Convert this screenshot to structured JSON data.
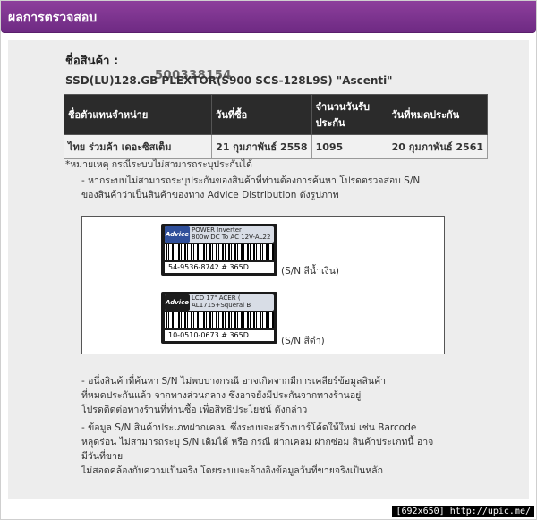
{
  "header": {
    "title": "ผลการตรวจสอบ"
  },
  "product": {
    "label": "ชื่อสินค้า :",
    "serial": "500338154",
    "model": "SSD(LU)128.GB PLEXTOR(S900 SCS-128L9S) \"Ascenti\""
  },
  "table": {
    "headers": [
      "ชื่อตัวแทนจำหน่าย",
      "วันที่ซื้อ",
      "จำนวนวันรับประกัน",
      "วันที่หมดประกัน"
    ],
    "rows": [
      [
        "ไทย ร่วมค้า เดอะซิสเต็ม",
        "21 กุมภาพันธ์ 2558",
        "1095",
        "20 กุมภาพันธ์ 2561"
      ]
    ]
  },
  "notes": {
    "title": "*หมายเหตุ กรณีระบบไม่สามารถระบุประกันได้",
    "line1": "- หากระบบไม่สามารถระบุประกันของสินค้าที่ท่านต้องการค้นหา โปรดตรวจสอบ S/N",
    "line2": "ของสินค้าว่าเป็นสินค้าของทาง Advice Distribution ดังรูปภาพ",
    "line3": "- อนึ่งสินค้าที่ค้นหา S/N ไม่พบบางกรณี อาจเกิดจากมีการเคลียร์ข้อมูลสินค้า",
    "line4": "ที่หมดประกันแล้ว จากทางส่วนกลาง ซึ่งอาจยังมีประกันจากทางร้านอยู่",
    "line5": "โปรดติดต่อทางร้านที่ท่านซื้อ เพื่อสิทธิประโยชน์ ดังกล่าว",
    "line6": "- ข้อมูล S/N สินค้าประเภทฝากเคลม ซึ่งระบบจะสร้างบาร์โค้ดให้ใหม่ เช่น Barcode",
    "line7": "หลุดร่อน ไม่สามารถระบุ S/N เดิมได้ หรือ กรณี ฝากเคลม ฝากซ่อม สินค้าประเภทนี้ อาจ",
    "line8": "มีวันที่ขาย",
    "line9": "ไม่สอดคล้องกับความเป็นจริง โดยระบบจะอ้างอิงข้อมูลวันที่ขายจริงเป็นหลัก"
  },
  "samples": {
    "blue": {
      "brand": "Advice",
      "desc1": "POWER Inverter",
      "desc2": "800w DC To AC 12V-AL22",
      "sn": "54-9536-8742 # 365D",
      "caption": "(S/N สีน้ำเงิน)"
    },
    "dark": {
      "brand": "Advice",
      "desc1": "LCD 17\" ACER (",
      "desc2": "AL1715+Squeral B",
      "sn": "10-0510-0673 # 365D",
      "caption": "(S/N สีดำ)"
    }
  },
  "watermark": "[692x650] http://upic.me/"
}
